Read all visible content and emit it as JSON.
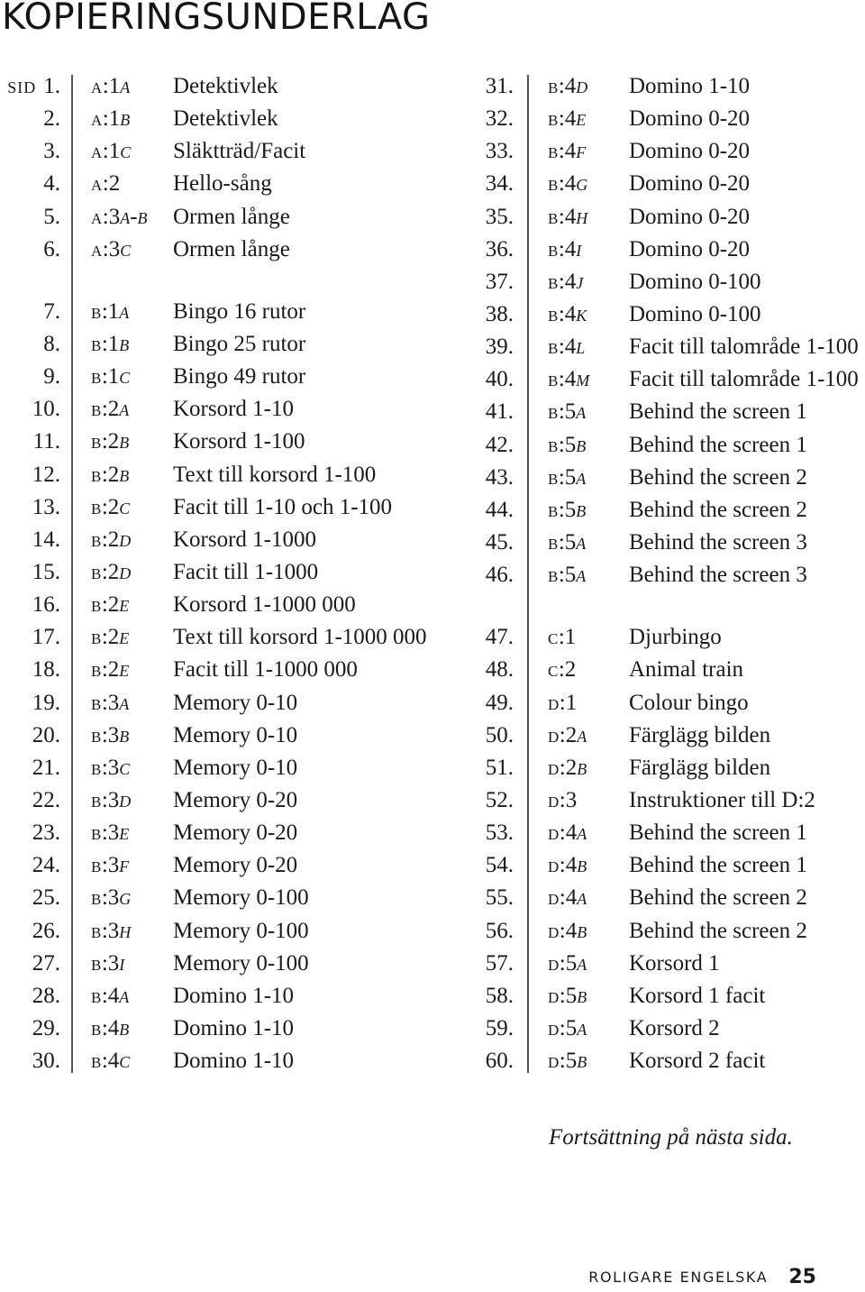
{
  "title": "KOPIERINGSUNDERLAG",
  "sid_label": "sid",
  "left_column": [
    {
      "num": "1.",
      "letter": "A",
      "base": ":1",
      "suffix": "a",
      "desc": "Detektivlek"
    },
    {
      "num": "2.",
      "letter": "A",
      "base": ":1",
      "suffix": "b",
      "desc": "Detektivlek"
    },
    {
      "num": "3.",
      "letter": "A",
      "base": ":1",
      "suffix": "c",
      "desc": "Släktträd/Facit"
    },
    {
      "num": "4.",
      "letter": "A",
      "base": ":2",
      "suffix": "",
      "desc": "Hello-sång"
    },
    {
      "num": "5.",
      "letter": "A",
      "base": ":3",
      "suffix": "a-b",
      "desc": "Ormen långe"
    },
    {
      "num": "6.",
      "letter": "A",
      "base": ":3",
      "suffix": "c",
      "desc": "Ormen långe"
    },
    {
      "num": "7.",
      "letter": "B",
      "base": ":1",
      "suffix": "a",
      "desc": "Bingo 16 rutor"
    },
    {
      "num": "8.",
      "letter": "B",
      "base": ":1",
      "suffix": "b",
      "desc": "Bingo 25 rutor"
    },
    {
      "num": "9.",
      "letter": "B",
      "base": ":1",
      "suffix": "c",
      "desc": "Bingo 49 rutor"
    },
    {
      "num": "10.",
      "letter": "B",
      "base": ":2",
      "suffix": "a",
      "desc": "Korsord 1-10"
    },
    {
      "num": "11.",
      "letter": "B",
      "base": ":2",
      "suffix": "b",
      "desc": "Korsord 1-100"
    },
    {
      "num": "12.",
      "letter": "B",
      "base": ":2",
      "suffix": "b",
      "desc": "Text till korsord 1-100"
    },
    {
      "num": "13.",
      "letter": "B",
      "base": ":2",
      "suffix": "c",
      "desc": "Facit till 1-10 och 1-100"
    },
    {
      "num": "14.",
      "letter": "B",
      "base": ":2",
      "suffix": "d",
      "desc": "Korsord 1-1000"
    },
    {
      "num": "15.",
      "letter": "B",
      "base": ":2",
      "suffix": "d",
      "desc": "Facit till 1-1000"
    },
    {
      "num": "16.",
      "letter": "B",
      "base": ":2",
      "suffix": "e",
      "desc": "Korsord 1-1000 000"
    },
    {
      "num": "17.",
      "letter": "B",
      "base": ":2",
      "suffix": "e",
      "desc": "Text till korsord 1-1000 000"
    },
    {
      "num": "18.",
      "letter": "B",
      "base": ":2",
      "suffix": "e",
      "desc": "Facit till 1-1000 000"
    },
    {
      "num": "19.",
      "letter": "B",
      "base": ":3",
      "suffix": "a",
      "desc": "Memory 0-10"
    },
    {
      "num": "20.",
      "letter": "B",
      "base": ":3",
      "suffix": "b",
      "desc": "Memory 0-10"
    },
    {
      "num": "21.",
      "letter": "B",
      "base": ":3",
      "suffix": "c",
      "desc": "Memory 0-10"
    },
    {
      "num": "22.",
      "letter": "B",
      "base": ":3",
      "suffix": "d",
      "desc": "Memory 0-20"
    },
    {
      "num": "23.",
      "letter": "B",
      "base": ":3",
      "suffix": "e",
      "desc": "Memory 0-20"
    },
    {
      "num": "24.",
      "letter": "B",
      "base": ":3",
      "suffix": "f",
      "desc": "Memory 0-20"
    },
    {
      "num": "25.",
      "letter": "B",
      "base": ":3",
      "suffix": "g",
      "desc": "Memory 0-100"
    },
    {
      "num": "26.",
      "letter": "B",
      "base": ":3",
      "suffix": "h",
      "desc": "Memory 0-100"
    },
    {
      "num": "27.",
      "letter": "B",
      "base": ":3",
      "suffix": "i",
      "desc": "Memory 0-100"
    },
    {
      "num": "28.",
      "letter": "B",
      "base": ":4",
      "suffix": "a",
      "desc": "Domino 1-10"
    },
    {
      "num": "29.",
      "letter": "B",
      "base": ":4",
      "suffix": "b",
      "desc": "Domino 1-10"
    },
    {
      "num": "30.",
      "letter": "B",
      "base": ":4",
      "suffix": "c",
      "desc": "Domino 1-10"
    }
  ],
  "right_column": [
    {
      "num": "31.",
      "letter": "B",
      "base": ":4",
      "suffix": "d",
      "desc": "Domino 1-10"
    },
    {
      "num": "32.",
      "letter": "B",
      "base": ":4",
      "suffix": "e",
      "desc": "Domino 0-20"
    },
    {
      "num": "33.",
      "letter": "B",
      "base": ":4",
      "suffix": "f",
      "desc": "Domino 0-20"
    },
    {
      "num": "34.",
      "letter": "B",
      "base": ":4",
      "suffix": "g",
      "desc": "Domino 0-20"
    },
    {
      "num": "35.",
      "letter": "B",
      "base": ":4",
      "suffix": "h",
      "desc": "Domino 0-20"
    },
    {
      "num": "36.",
      "letter": "B",
      "base": ":4",
      "suffix": "i",
      "desc": "Domino 0-20"
    },
    {
      "num": "37.",
      "letter": "B",
      "base": ":4",
      "suffix": "j",
      "desc": "Domino 0-100"
    },
    {
      "num": "38.",
      "letter": "B",
      "base": ":4",
      "suffix": "k",
      "desc": "Domino 0-100"
    },
    {
      "num": "39.",
      "letter": "B",
      "base": ":4",
      "suffix": "l",
      "desc": "Facit till talområde 1-100"
    },
    {
      "num": "40.",
      "letter": "B",
      "base": ":4",
      "suffix": "m",
      "desc": "Facit till talområde 1-100"
    },
    {
      "num": "41.",
      "letter": "B",
      "base": ":5",
      "suffix": "a",
      "desc": "Behind the screen 1"
    },
    {
      "num": "42.",
      "letter": "B",
      "base": ":5",
      "suffix": "b",
      "desc": "Behind the screen 1"
    },
    {
      "num": "43.",
      "letter": "B",
      "base": ":5",
      "suffix": "a",
      "desc": "Behind the screen 2"
    },
    {
      "num": "44.",
      "letter": "B",
      "base": ":5",
      "suffix": "b",
      "desc": "Behind the screen 2"
    },
    {
      "num": "45.",
      "letter": "B",
      "base": ":5",
      "suffix": "a",
      "desc": "Behind the screen 3"
    },
    {
      "num": "46.",
      "letter": "B",
      "base": ":5",
      "suffix": "a",
      "desc": "Behind the screen 3"
    },
    {
      "num": "47.",
      "letter": "C",
      "base": ":1",
      "suffix": "",
      "desc": "Djurbingo"
    },
    {
      "num": "48.",
      "letter": "C",
      "base": ":2",
      "suffix": "",
      "desc": "Animal train"
    },
    {
      "num": "49.",
      "letter": "D",
      "base": ":1",
      "suffix": "",
      "desc": "Colour bingo"
    },
    {
      "num": "50.",
      "letter": "D",
      "base": ":2",
      "suffix": "a",
      "desc": "Färglägg bilden"
    },
    {
      "num": "51.",
      "letter": "D",
      "base": ":2",
      "suffix": "b",
      "desc": "Färglägg bilden"
    },
    {
      "num": "52.",
      "letter": "D",
      "base": ":3",
      "suffix": "",
      "desc": "Instruktioner till D:2"
    },
    {
      "num": "53.",
      "letter": "D",
      "base": ":4",
      "suffix": "a",
      "desc": "Behind the screen 1"
    },
    {
      "num": "54.",
      "letter": "D",
      "base": ":4",
      "suffix": "b",
      "desc": "Behind the screen 1"
    },
    {
      "num": "55.",
      "letter": "D",
      "base": ":4",
      "suffix": "a",
      "desc": "Behind the screen 2"
    },
    {
      "num": "56.",
      "letter": "D",
      "base": ":4",
      "suffix": "b",
      "desc": "Behind the screen 2"
    },
    {
      "num": "57.",
      "letter": "D",
      "base": ":5",
      "suffix": "a",
      "desc": "Korsord 1"
    },
    {
      "num": "58.",
      "letter": "D",
      "base": ":5",
      "suffix": "b",
      "desc": "Korsord 1 facit"
    },
    {
      "num": "59.",
      "letter": "D",
      "base": ":5",
      "suffix": "a",
      "desc": "Korsord 2"
    },
    {
      "num": "60.",
      "letter": "D",
      "base": ":5",
      "suffix": "b",
      "desc": "Korsord 2 facit"
    }
  ],
  "continuation_note": "Fortsättning på nästa sida.",
  "footer": {
    "book_title": "ROLIGARE ENGELSKA",
    "page_number": "25"
  }
}
